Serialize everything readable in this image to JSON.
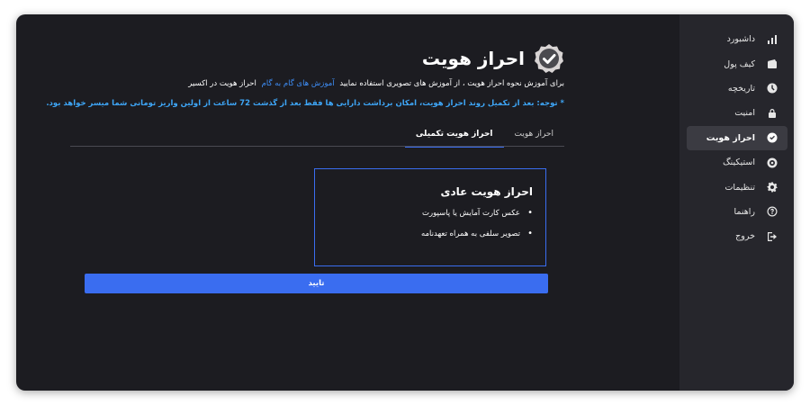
{
  "sidebar": {
    "items": [
      {
        "label": "داشبورد",
        "icon": "bar-chart-icon"
      },
      {
        "label": "کیف پول",
        "icon": "wallet-icon"
      },
      {
        "label": "تاریخچه",
        "icon": "clock-icon"
      },
      {
        "label": "امنیت",
        "icon": "lock-icon"
      },
      {
        "label": "احراز هویت",
        "icon": "verified-check-icon",
        "active": true
      },
      {
        "label": "استیکینگ",
        "icon": "staking-icon"
      },
      {
        "label": "تنظیمات",
        "icon": "gear-icon"
      },
      {
        "label": "راهنما",
        "icon": "help-icon"
      },
      {
        "label": "خروج",
        "icon": "logout-icon"
      }
    ]
  },
  "header": {
    "title": "احراز هویت"
  },
  "intro": {
    "before": "برای آموزش نحوه احراز هویت ، از آموزش های تصویری استفاده نمایید",
    "link": "آموزش های گام به گام",
    "after": "احراز هویت در اکسیر"
  },
  "note": "* توجه: بعد از تکمیل روند احراز هویت، امکان برداشت دارایی ها فقط بعد از گذشت 72 ساعت از اولین واریز تومانی شما میسر خواهد بود.",
  "tabs": [
    {
      "label": "احراز هویت",
      "active": false
    },
    {
      "label": "احراز هویت تکمیلی",
      "active": true
    }
  ],
  "card": {
    "title": "احراز هویت عادی",
    "items": [
      "عکس کارت آمایش یا پاسپورت",
      "تصویر سلفی به همراه تعهدنامه"
    ]
  },
  "confirm_label": "تایید",
  "colors": {
    "background": "#1c1c21",
    "sidebar": "#26262c",
    "accent": "#3a6df0",
    "link": "#3e8ef7",
    "note": "#3ea6f7"
  }
}
